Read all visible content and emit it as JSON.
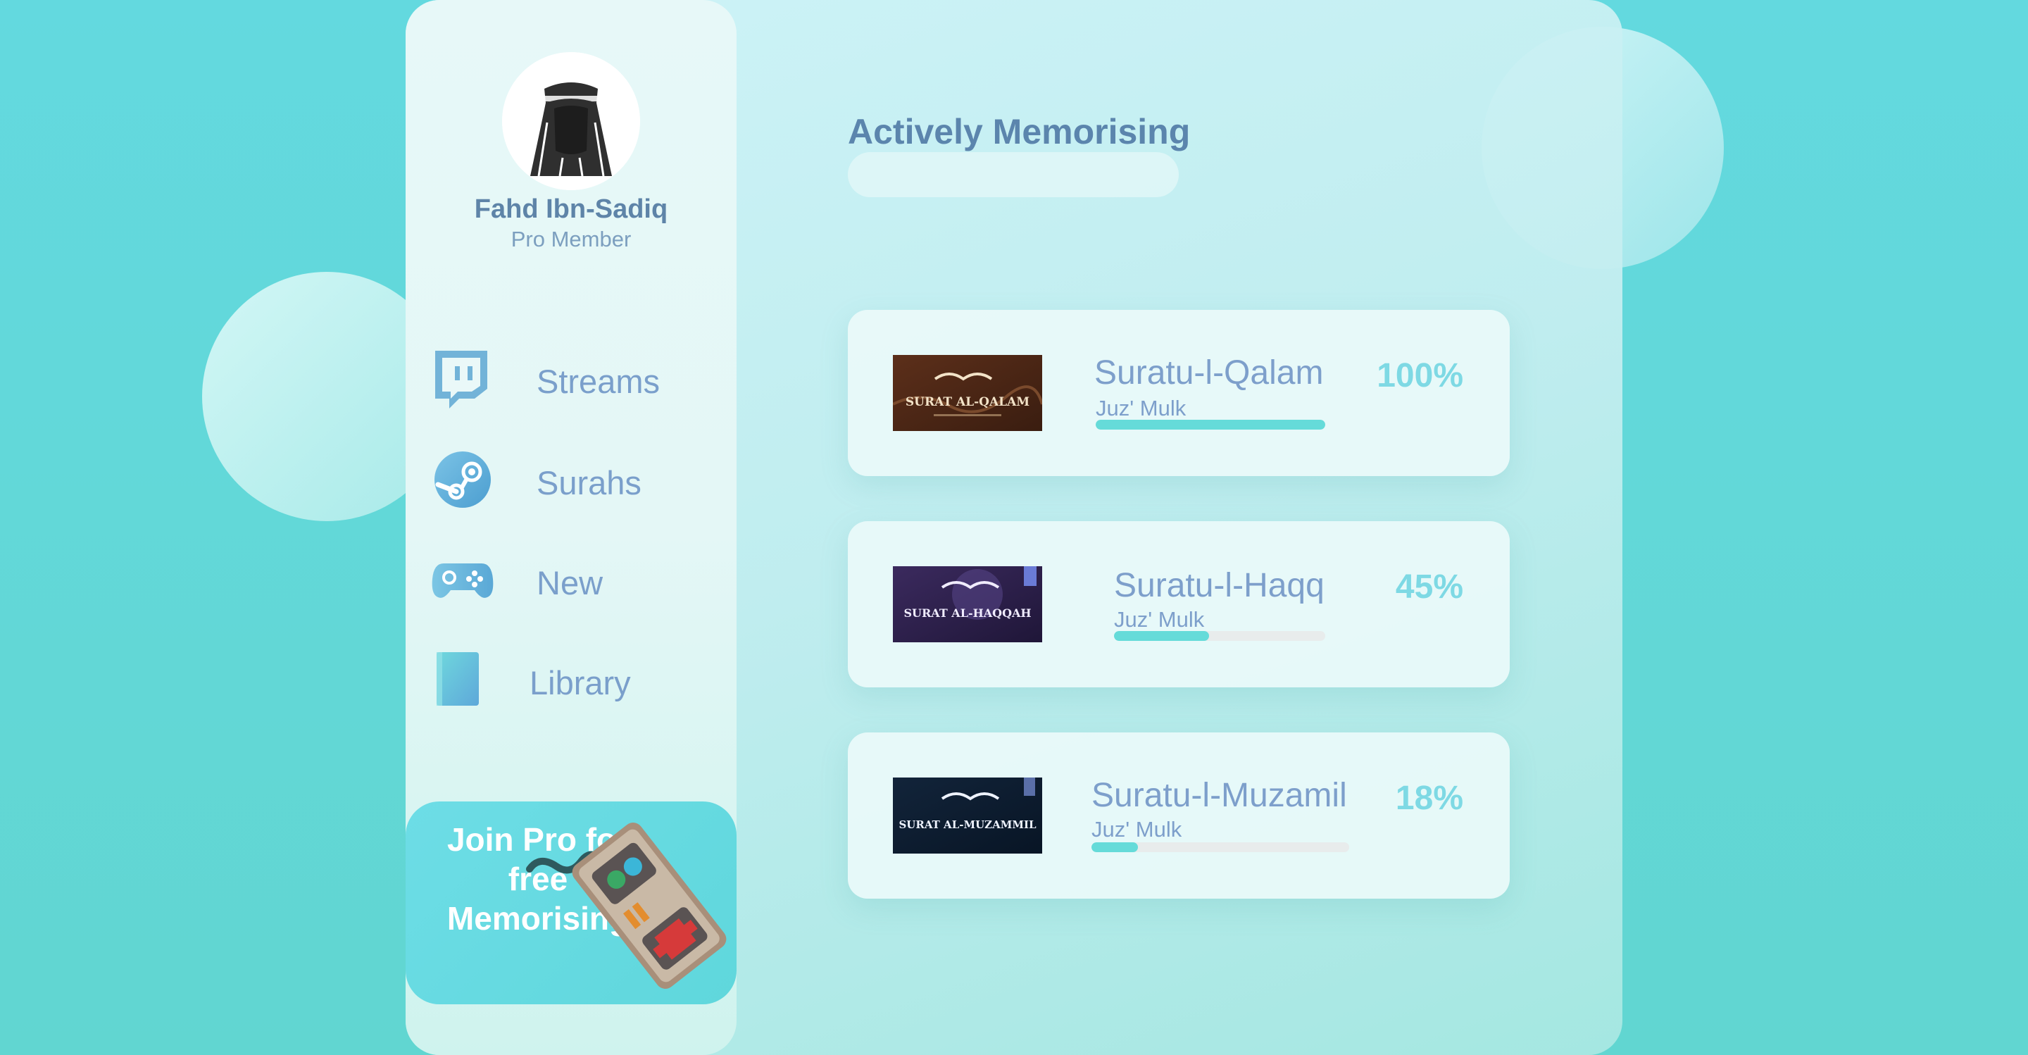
{
  "user": {
    "name": "Fahd Ibn-Sadiq",
    "role": "Pro Member"
  },
  "nav": [
    {
      "label": "Streams",
      "icon": "twitch-icon"
    },
    {
      "label": "Surahs",
      "icon": "steam-icon"
    },
    {
      "label": "New",
      "icon": "gamepad-icon"
    },
    {
      "label": "Library",
      "icon": "book-icon"
    }
  ],
  "promo": {
    "text": "Join Pro for free Memorising"
  },
  "main": {
    "title": "Actively Memorising",
    "search_value": ""
  },
  "surahs": [
    {
      "name": "Suratu-l-Qalam",
      "juz": "Juz' Mulk",
      "percent": "100%",
      "progress": 1.0,
      "thumb_label": "SURAT AL-QALAM"
    },
    {
      "name": "Suratu-l-Haqq",
      "juz": "Juz' Mulk",
      "percent": "45%",
      "progress": 0.45,
      "thumb_label": "SURAT AL-HAQQAH"
    },
    {
      "name": "Suratu-l-Muzamil",
      "juz": "Juz' Mulk",
      "percent": "18%",
      "progress": 0.18,
      "thumb_label": "SURAT AL-MUZAMMIL"
    }
  ],
  "colors": {
    "accent": "#65dbd9",
    "text_blue": "#7d9fcb",
    "title_blue": "#5b85ad",
    "percent": "#7ed9e4"
  }
}
